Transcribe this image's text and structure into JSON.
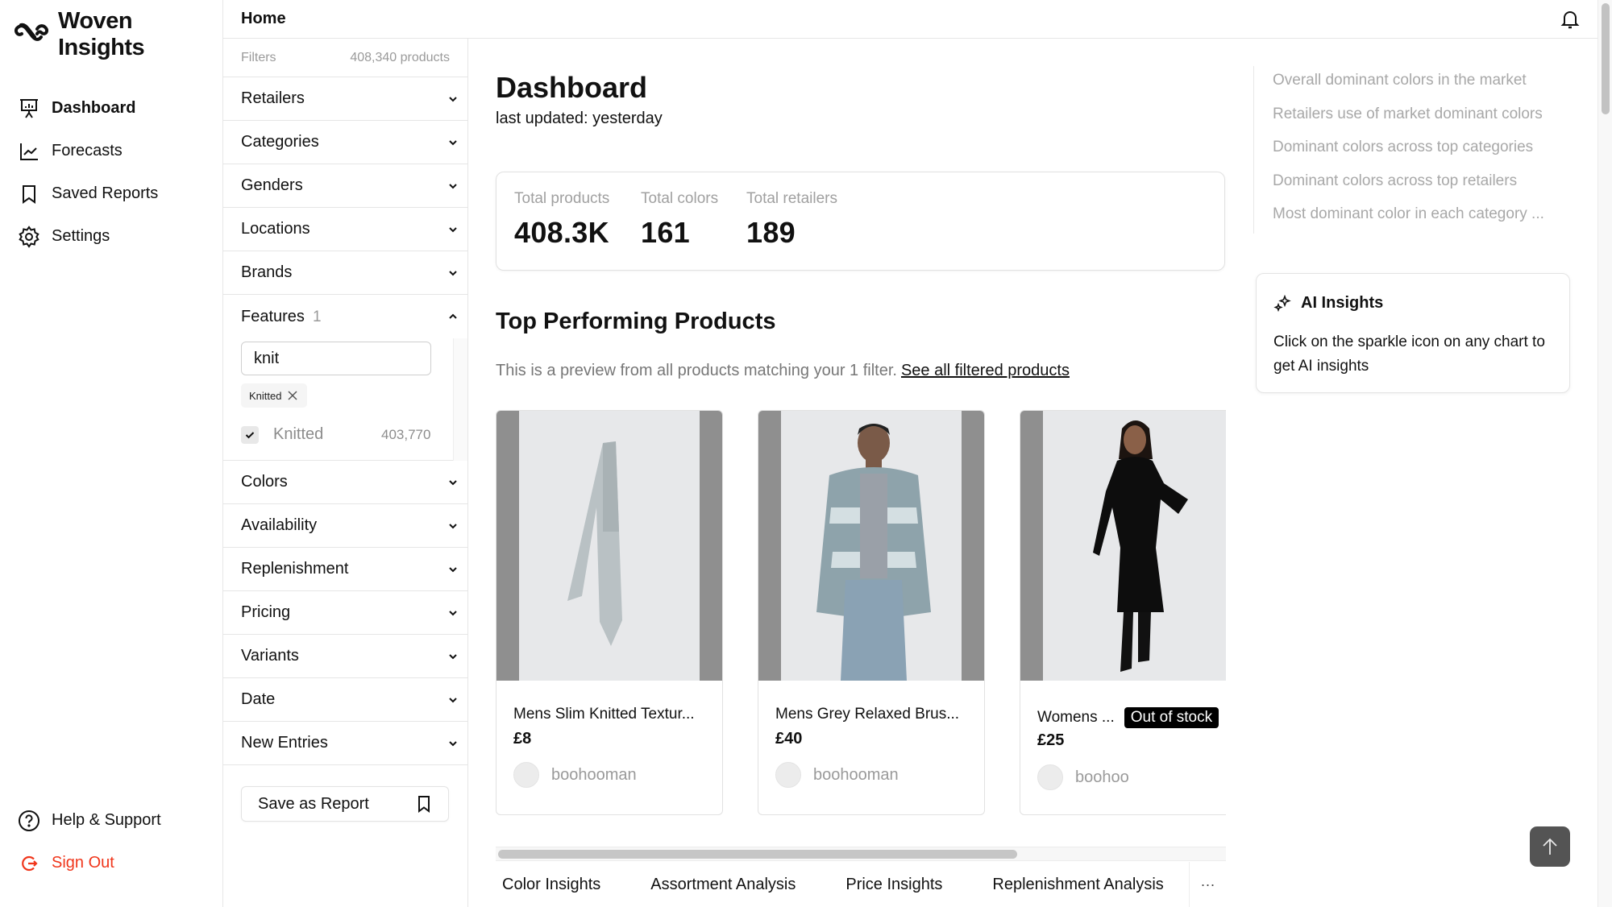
{
  "app": {
    "name": "Woven Insights"
  },
  "sidebar": {
    "items": [
      {
        "label": "Dashboard",
        "icon": "presentation-chart-icon",
        "active": true
      },
      {
        "label": "Forecasts",
        "icon": "line-chart-icon",
        "active": false
      },
      {
        "label": "Saved Reports",
        "icon": "bookmark-icon",
        "active": false
      },
      {
        "label": "Settings",
        "icon": "gear-icon",
        "active": false
      }
    ],
    "bottom": [
      {
        "label": "Help & Support",
        "icon": "help-circle-icon"
      },
      {
        "label": "Sign Out",
        "icon": "sign-out-icon"
      }
    ]
  },
  "header": {
    "title": "Home",
    "notification_icon": "bell-icon"
  },
  "filters": {
    "label": "Filters",
    "product_count": "408,340 products",
    "groups": [
      {
        "label": "Retailers"
      },
      {
        "label": "Categories"
      },
      {
        "label": "Genders"
      },
      {
        "label": "Locations"
      },
      {
        "label": "Brands"
      },
      {
        "label": "Features",
        "count": "1",
        "expanded": true
      },
      {
        "label": "Colors"
      },
      {
        "label": "Availability"
      },
      {
        "label": "Replenishment"
      },
      {
        "label": "Pricing"
      },
      {
        "label": "Variants"
      },
      {
        "label": "Date"
      },
      {
        "label": "New Entries"
      }
    ],
    "features": {
      "search_value": "knit",
      "selected_chips": [
        "Knitted"
      ],
      "options": [
        {
          "label": "Knitted",
          "count": "403,770",
          "checked": true
        }
      ]
    },
    "save_button": "Save as Report"
  },
  "main": {
    "title": "Dashboard",
    "last_updated": "last updated: yesterday",
    "stats": [
      {
        "label": "Total products",
        "value": "408.3K"
      },
      {
        "label": "Total colors",
        "value": "161"
      },
      {
        "label": "Total retailers",
        "value": "189"
      }
    ],
    "section_title": "Top Performing Products",
    "preview_text": "This is a preview from all products matching your 1 filter.",
    "preview_link": "See all filtered products",
    "products": [
      {
        "name": "Mens Slim Knitted Textur...",
        "price": "£8",
        "retailer": "boohooman",
        "badge": null
      },
      {
        "name": "Mens Grey Relaxed Brus...",
        "price": "£40",
        "retailer": "boohooman",
        "badge": null
      },
      {
        "name": "Womens ...",
        "price": "£25",
        "retailer": "boohoo",
        "badge": "Out of stock"
      }
    ],
    "tabs": [
      {
        "label": "Color Insights"
      },
      {
        "label": "Assortment Analysis"
      },
      {
        "label": "Price Insights"
      },
      {
        "label": "Replenishment Analysis"
      }
    ],
    "tabs_more": "···"
  },
  "toc": {
    "items": [
      "Overall dominant colors in the market",
      "Retailers use of market dominant colors",
      "Dominant colors across top categories",
      "Dominant colors across top retailers",
      "Most dominant color in each category ..."
    ]
  },
  "ai_insights": {
    "title": "AI Insights",
    "text": "Click on the sparkle icon on any chart to get AI insights"
  },
  "colors": {
    "sign_out": "#f0361b",
    "badge_bg": "#000000",
    "scroll_top_button": "#545454"
  }
}
